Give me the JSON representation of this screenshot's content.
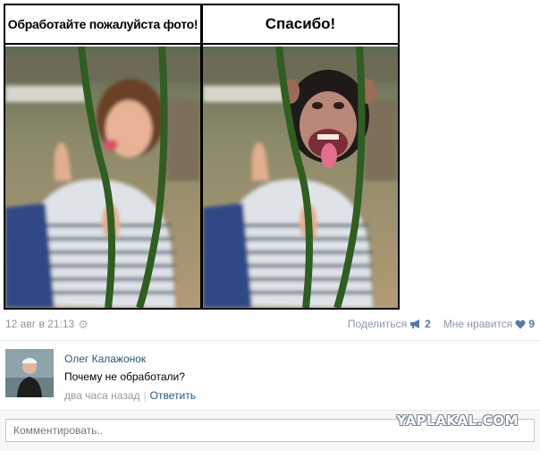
{
  "comic": {
    "left_caption": "Обработайте пожалуйста фото!",
    "right_caption": "Спасибо!"
  },
  "post": {
    "date": "12 авг в 21:13",
    "share_label": "Поделиться",
    "share_count": "2",
    "like_label": "Мне нравится",
    "like_count": "9"
  },
  "comment": {
    "author": "Олег Калажонок",
    "text": "Почему не обработали?",
    "time": "два часа назад",
    "separator": "|",
    "reply_label": "Ответить"
  },
  "comment_input": {
    "placeholder": "Комментировать.."
  },
  "watermark": "YAPLAKAL.COM",
  "colors": {
    "link": "#2b587a",
    "meta_gray": "#939393",
    "like_blue": "#5a7ba6",
    "swing_green": "#2f5d22"
  },
  "icons": {
    "settings": "gear-icon",
    "share": "megaphone-icon",
    "like": "heart-icon"
  }
}
